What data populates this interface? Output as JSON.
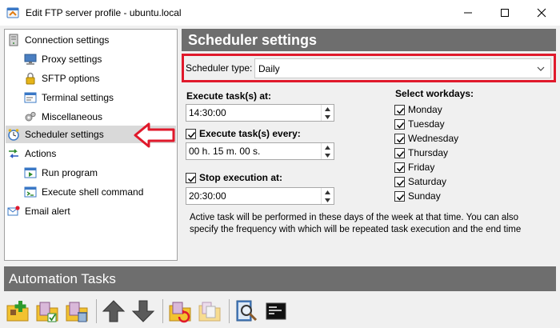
{
  "window": {
    "title": "Edit FTP server profile - ubuntu.local"
  },
  "tree": {
    "items": [
      {
        "label": "Connection settings",
        "icon": "server-icon"
      },
      {
        "label": "Proxy settings",
        "icon": "monitor-network-icon"
      },
      {
        "label": "SFTP options",
        "icon": "lock-icon"
      },
      {
        "label": "Terminal settings",
        "icon": "terminal-window-icon"
      },
      {
        "label": "Miscellaneous",
        "icon": "gears-icon"
      },
      {
        "label": "Scheduler settings",
        "icon": "clock-icon"
      },
      {
        "label": "Actions",
        "icon": "arrows-icon"
      },
      {
        "label": "Run program",
        "icon": "run-program-icon"
      },
      {
        "label": "Execute shell command",
        "icon": "shell-command-icon"
      },
      {
        "label": "Email alert",
        "icon": "email-alert-icon"
      }
    ]
  },
  "panel": {
    "title": "Scheduler settings",
    "scheduler_type_label": "Scheduler type:",
    "scheduler_type_value": "Daily",
    "execute_at_label": "Execute task(s) at:",
    "execute_at_value": "14:30:00",
    "execute_every_label": "Execute task(s) every:",
    "execute_every_value": "00 h. 15 m. 00 s.",
    "stop_label": "Stop execution at:",
    "stop_value": "20:30:00",
    "workdays_label": "Select workdays:",
    "workdays": [
      "Monday",
      "Tuesday",
      "Wednesday",
      "Thursday",
      "Friday",
      "Saturday",
      "Sunday"
    ],
    "help_text": "Active task will be performed in these days of the week at that time. You can also specify the frequency with which will be repeated task execution and the end time"
  },
  "automation": {
    "title": "Automation Tasks"
  },
  "colors": {
    "highlight": "#e0192b",
    "header_bg": "#6e6e6e"
  }
}
